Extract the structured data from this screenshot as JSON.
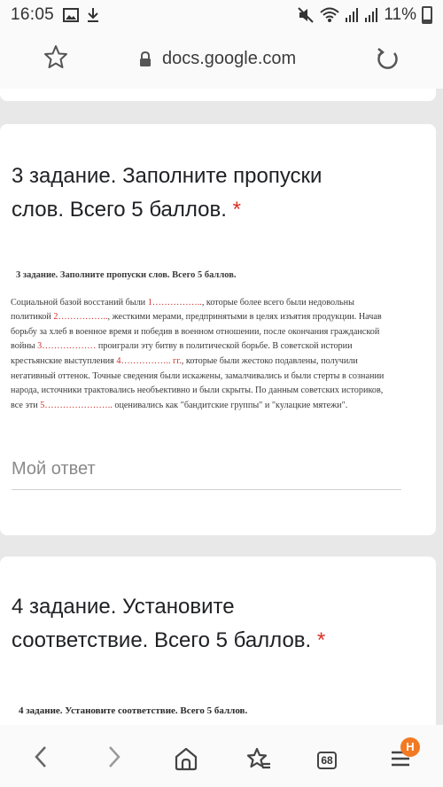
{
  "status_bar": {
    "time": "16:05",
    "battery": "11%"
  },
  "browser": {
    "url": "docs.google.com",
    "tabs_count": "68",
    "menu_badge": "H"
  },
  "questions": [
    {
      "title_line1": "3 задание. Заполните пропуски",
      "title_line2": "слов. Всего 5 баллов.",
      "required_mark": "*",
      "scan_heading": "3 задание. Заполните пропуски слов. Всего 5 баллов.",
      "scan_text": {
        "l1a": "Социальной базой восстаний были ",
        "d1": "1……………..",
        "l1b": ", которые более всего были недовольны",
        "l2a": "политикой ",
        "d2": "2……………..",
        "l2b": ", жесткими мерами, предпринятыми в целях изъятия продукции. Начав",
        "l3": "борьбу за хлеб в военное время и победив в военном отношении, после окончания гражданской",
        "l4a": "войны ",
        "d3": "3………………",
        "l4b": " проиграли эту битву в политической борьбе. В советской истории",
        "l5a": "крестьянские выступления ",
        "d4": "4…………….. гг.",
        "l5b": ", которые были жестоко подавлены, получили",
        "l6": "негативный оттенок. Точные сведения были искажены, замалчивались и были стерты в сознании",
        "l7": "народа, источники трактовались необъективно и были скрыты. По данным советских историков,",
        "l8a": "все эти ",
        "d5": "5…………………..",
        "l8b": " оценивались как \"бандитские группы\" и \"кулацкие мятежи\"."
      },
      "answer_placeholder": "Мой ответ"
    },
    {
      "title_line1": "4 задание. Установите",
      "title_line2": "соответствие. Всего 5 баллов.",
      "required_mark": "*",
      "scan_heading": "4 задание. Установите соответствие. Всего 5 баллов."
    }
  ]
}
